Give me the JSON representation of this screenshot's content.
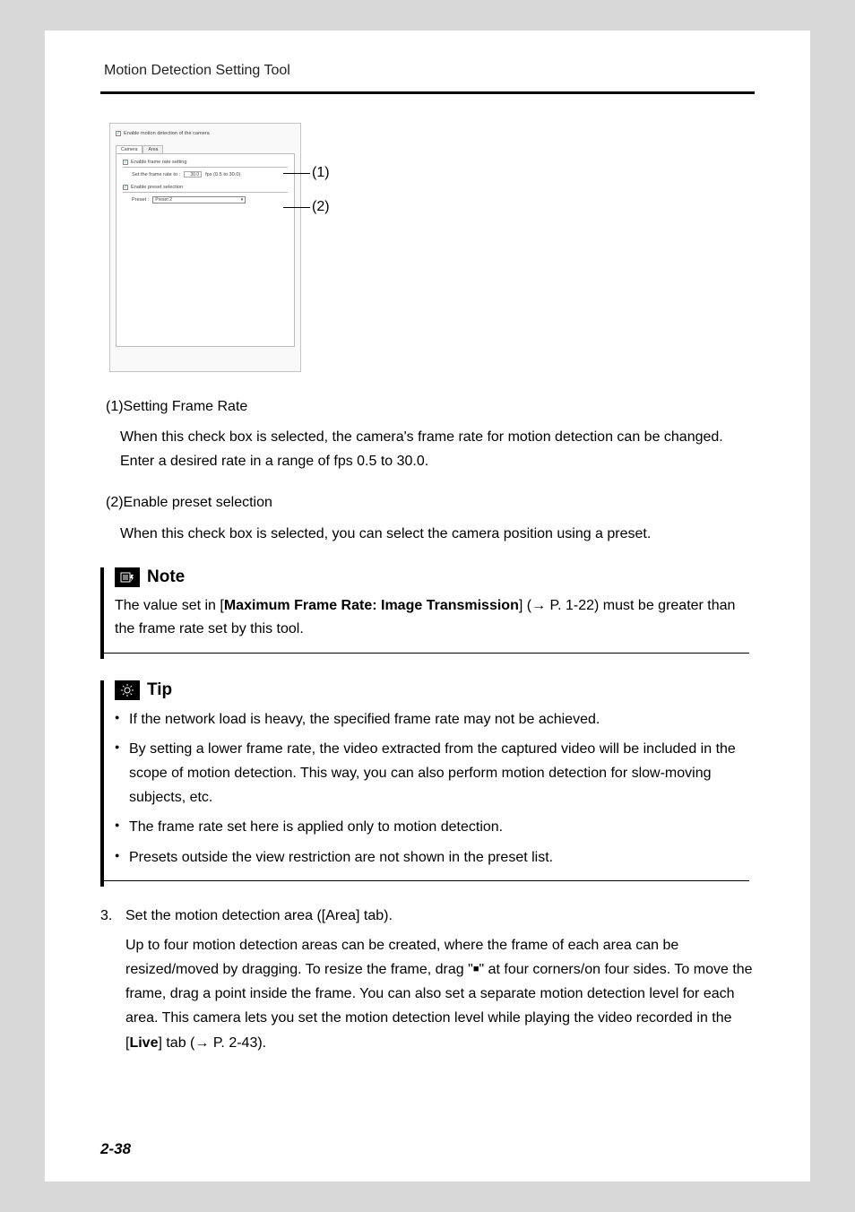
{
  "header": {
    "title": "Motion Detection Setting Tool"
  },
  "panel": {
    "enableDetection": "Enable motion detection of the camera",
    "tabs": {
      "camera": "Camera",
      "area": "Area"
    },
    "sec1": {
      "hdr": "Enable frame rate setting",
      "label": "Set the frame rate to :",
      "value": "30.0",
      "unit": "fps (0.5 to 30.0)"
    },
    "sec2": {
      "hdr": "Enable preset selection",
      "label": "Preset :",
      "selected": "Preset 2"
    }
  },
  "callouts": {
    "c1": "(1)",
    "c2": "(2)"
  },
  "item1": {
    "heading": "(1)Setting Frame Rate",
    "text": "When this check box is selected, the camera's frame rate for motion detection can be changed. Enter a desired rate in a range of fps 0.5 to 30.0."
  },
  "item2": {
    "heading": "(2)Enable preset selection",
    "text": "When this check box is selected, you can select the camera position using a preset."
  },
  "note": {
    "title": "Note",
    "pre": "The value set in [",
    "bold": "Maximum Frame Rate: Image Transmission",
    "post": "] (→ P. 1-22) must be greater than the frame rate set by this tool."
  },
  "tip": {
    "title": "Tip",
    "items": [
      "If the network load is heavy, the specified frame rate may not be achieved.",
      "By setting a lower frame rate, the video extracted from the captured video will be included in the scope of motion detection. This way, you can also perform motion detection for slow-moving subjects, etc.",
      "The frame rate set here is applied only to motion detection.",
      "Presets outside the view restriction are not shown in the preset list."
    ]
  },
  "step3": {
    "num": "3.",
    "title": "Set the motion detection area ([Area] tab).",
    "body_a": "Up to four motion detection areas can be created, where the frame of each area can be resized/moved by dragging. To resize the frame, drag \"",
    "body_b": "\" at four corners/on four sides. To move the frame, drag a point inside the frame. You can also set a separate motion detection level for each area. This camera lets you set the motion detection level while playing the video recorded in the [",
    "live": "Live",
    "body_c": "] tab (→ P. 2-43)."
  },
  "footer": "2-38"
}
